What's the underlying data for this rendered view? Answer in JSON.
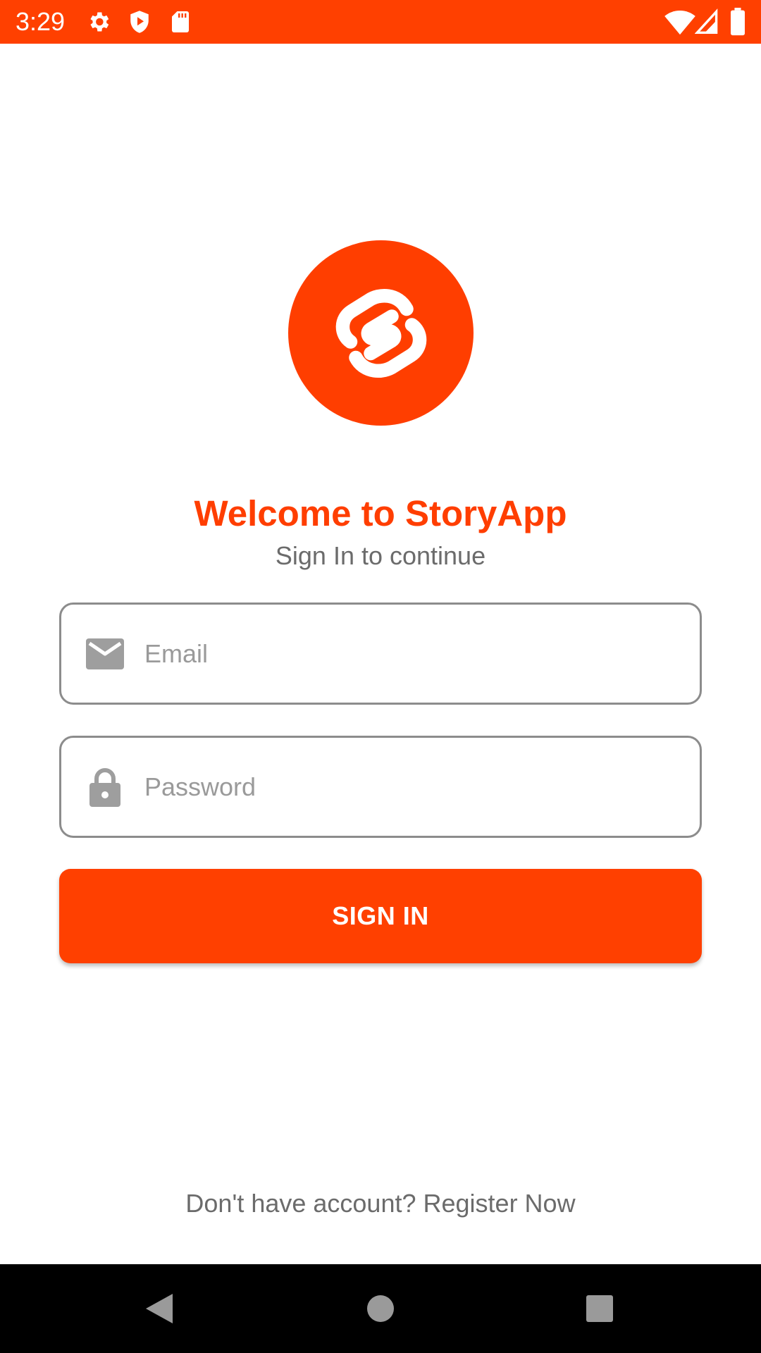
{
  "status_bar": {
    "time": "3:29",
    "icons_left": [
      "settings-gear-icon",
      "shield-play-icon",
      "sd-card-icon"
    ],
    "icons_right": [
      "wifi-icon",
      "cell-signal-icon",
      "battery-icon"
    ]
  },
  "logo": {
    "icon": "svelte-logo-icon",
    "color": "#FF3E00"
  },
  "header": {
    "title": "Welcome to StoryApp",
    "subtitle": "Sign In to continue"
  },
  "form": {
    "email": {
      "placeholder": "Email",
      "value": "",
      "icon": "mail-icon"
    },
    "password": {
      "placeholder": "Password",
      "value": "",
      "icon": "lock-icon"
    },
    "submit_label": "SIGN IN"
  },
  "footer": {
    "register_text": "Don't have account? Register Now"
  },
  "nav_bar": {
    "buttons": [
      "back-icon",
      "home-icon",
      "recents-icon"
    ]
  },
  "colors": {
    "accent": "#FF4000",
    "text_secondary": "#6b6b6b",
    "border": "#8c8c8c"
  }
}
